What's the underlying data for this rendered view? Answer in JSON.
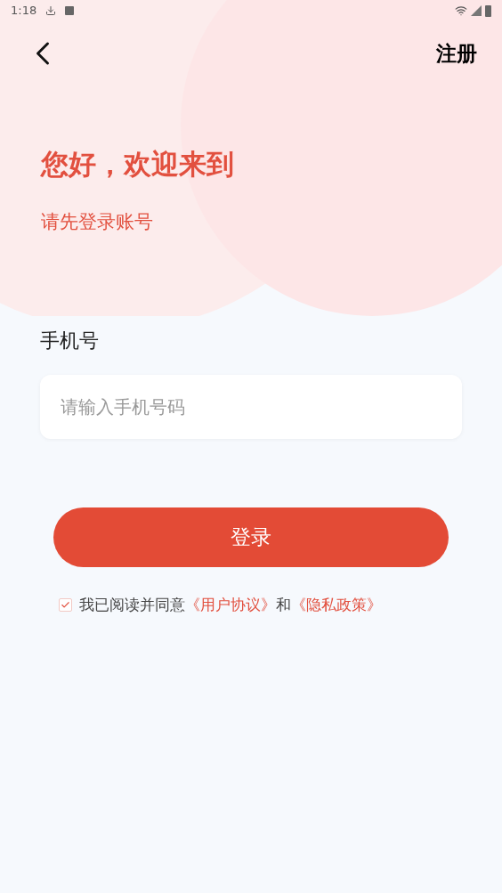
{
  "status_bar": {
    "time": "1:18"
  },
  "header": {
    "action": "注册"
  },
  "greeting": {
    "title": "您好，欢迎来到",
    "subtitle": "请先登录账号"
  },
  "phone_field": {
    "label": "手机号",
    "placeholder": "请输入手机号码"
  },
  "login_button": "登录",
  "agreement": {
    "checked": true,
    "text": "我已阅读并同意",
    "link_1": "《用户协议》",
    "joiner": "和",
    "link_2": "《隐私政策》"
  }
}
